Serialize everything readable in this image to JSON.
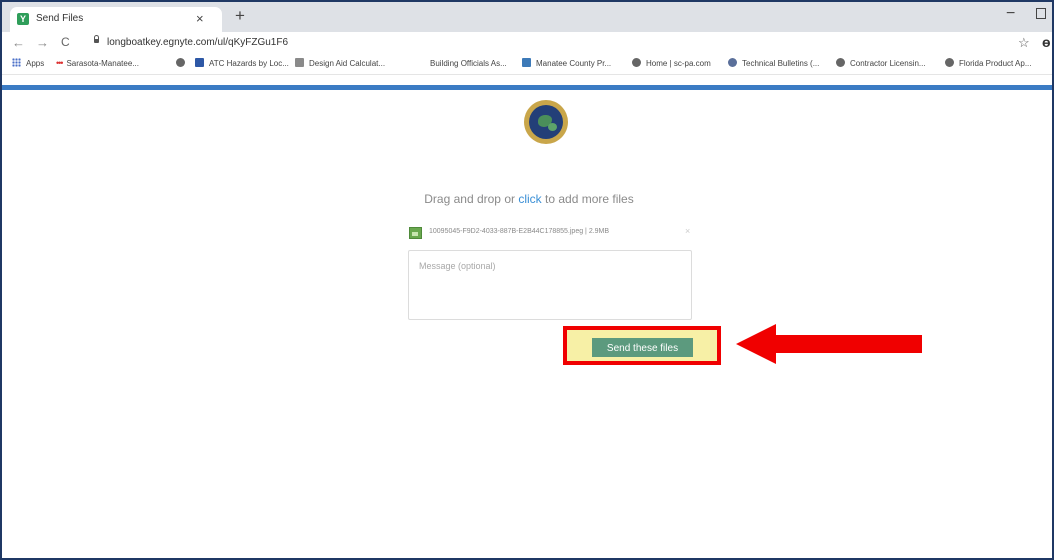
{
  "browser": {
    "tab_title": "Send Files",
    "tab_close": "×",
    "new_tab": "+",
    "minimize": "−",
    "back": "←",
    "forward": "→",
    "reload": "C",
    "url": "longboatkey.egnyte.com/ul/qKyFZGu1F6",
    "star": "☆",
    "profile": "ɵ"
  },
  "bookmarks": [
    {
      "label": "Apps",
      "icon": "apps-icon"
    },
    {
      "label": "Sarasota-Manatee...",
      "icon": "dots-icon"
    },
    {
      "label": "",
      "icon": "globe-icon"
    },
    {
      "label": "ATC Hazards by Loc...",
      "icon": "atc-icon"
    },
    {
      "label": "Design Aid Calculat...",
      "icon": "ibc-icon"
    },
    {
      "label": "Building Officials As...",
      "icon": "boa-icon"
    },
    {
      "label": "Manatee County Pr...",
      "icon": "manatee-icon"
    },
    {
      "label": "Home | sc-pa.com",
      "icon": "globe-icon"
    },
    {
      "label": "Technical Bulletins (...",
      "icon": "bulletin-icon"
    },
    {
      "label": "Contractor Licensin...",
      "icon": "globe-icon"
    },
    {
      "label": "Florida Product Ap...",
      "icon": "globe-icon"
    }
  ],
  "page": {
    "drop_text_before": "Drag and drop or ",
    "drop_link": "click",
    "drop_text_after": " to add more files",
    "file_name": "10095045-F9D2-4033-887B-E2B44C178855.jpeg | 2.9MB",
    "file_remove": "×",
    "message_placeholder": "Message (optional)",
    "send_label": "Send these files"
  },
  "colors": {
    "accent_blue": "#3b7bc4",
    "send_button": "#5c9a7e",
    "annotation_red": "#f00000",
    "highlight_yellow": "#f7f0a6"
  }
}
